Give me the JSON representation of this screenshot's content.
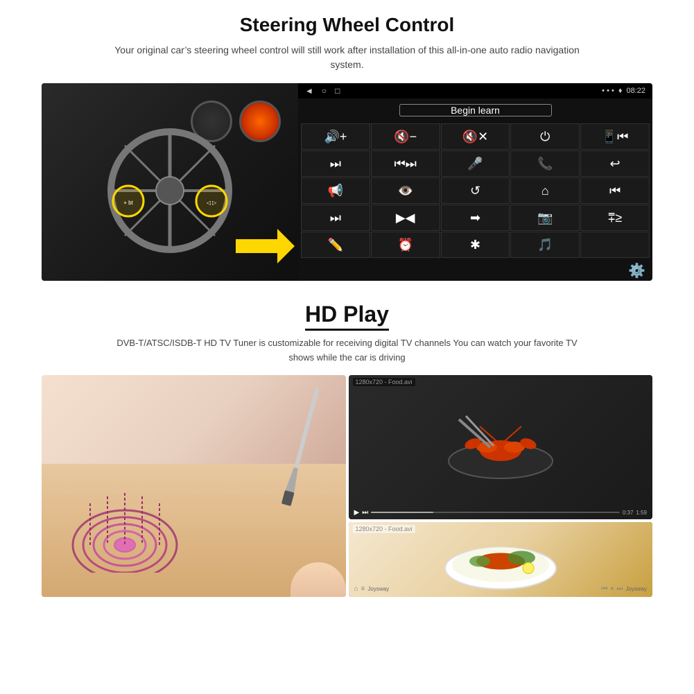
{
  "page": {
    "background": "#ffffff"
  },
  "section1": {
    "title": "Steering Wheel Control",
    "subtitle": "Your original car’s steering wheel control will still work after installation of this all-in-one auto radio navigation system.",
    "android": {
      "time": "08:22",
      "begin_learn": "Begin learn",
      "nav_icons": [
        "◄",
        "○",
        "□"
      ],
      "status_icons": [
        "•••",
        "¶",
        "08:22"
      ]
    }
  },
  "section2": {
    "title": "HD Play",
    "subtitle": "DVB-T/ATSC/ISDB-T HD TV Tuner is customizable for receiving digital TV channels You can watch your favorite TV shows while the car is driving",
    "video_top_label": "1280x720 - Food.avi",
    "video_bottom_label": "1280x720 - Food.avi",
    "time_left": "0:37",
    "time_right": "1:59"
  },
  "icons": {
    "grid": [
      "🔊+",
      "🔇−",
      "🔇×",
      "⏻",
      "📲⏮",
      "⏭",
      "⏮⏭",
      "🎤",
      "📞",
      "↩",
      "📢",
      "👁️",
      "↺",
      "⌂",
      "⏮",
      "⏭",
      "▶◄",
      "➡",
      "📷",
      "⩱≥",
      "✏️",
      "⏰",
      "★",
      "🎵"
    ],
    "settings": "⚙️"
  }
}
